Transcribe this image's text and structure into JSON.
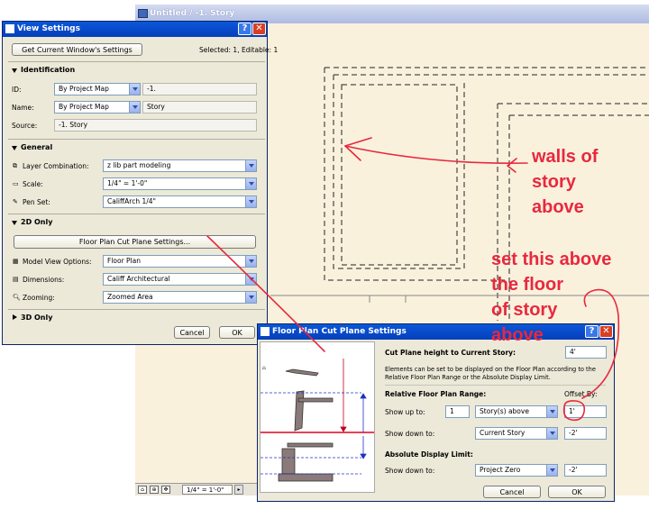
{
  "drawing_window": {
    "title": "Untitled / -1. Story",
    "scale": "1/4\"   =   1'-0\""
  },
  "view_settings": {
    "title": "View Settings",
    "get_settings_button": "Get Current Window's Settings",
    "selected_info": "Selected: 1, Editable: 1",
    "identification": {
      "header": "Identification",
      "id_label": "ID:",
      "id_select": "By Project Map",
      "id_value": "-1.",
      "name_label": "Name:",
      "name_select": "By Project Map",
      "name_value": "Story",
      "source_label": "Source:",
      "source_value": "-1. Story"
    },
    "general": {
      "header": "General",
      "layer_label": "Layer Combination:",
      "layer_value": "z lib part modeling",
      "scale_label": "Scale:",
      "scale_value": "1/4\"    =    1'-0\"",
      "penset_label": "Pen Set:",
      "penset_value": "CaliffArch 1/4\""
    },
    "two_d": {
      "header": "2D Only",
      "cutplane_button": "Floor Plan Cut Plane Settings...",
      "mvo_label": "Model View Options:",
      "mvo_value": "Floor Plan",
      "dim_label": "Dimensions:",
      "dim_value": "Califf Architectural",
      "zoom_label": "Zooming:",
      "zoom_value": "Zoomed Area"
    },
    "three_d": {
      "header": "3D Only"
    },
    "cancel": "Cancel",
    "ok": "OK"
  },
  "cut_plane": {
    "title": "Floor Plan Cut Plane Settings",
    "height_label": "Cut Plane height to Current Story:",
    "height_value": "4'",
    "description": "Elements can be set to be displayed on the Floor Plan according to the Relative Floor Plan Range or the Absolute Display Limit.",
    "relative_header": "Relative Floor Plan Range:",
    "offset_header": "Offset By:",
    "show_up_label": "Show up to:",
    "show_up_count": "1",
    "show_up_select": "Story(s) above",
    "show_up_offset": "1'",
    "show_down_label": "Show down to:",
    "show_down_select": "Current Story",
    "show_down_offset": "-2'",
    "absolute_header": "Absolute Display Limit:",
    "abs_down_label": "Show down to:",
    "abs_down_select": "Project Zero",
    "abs_down_offset": "-2'",
    "cancel": "Cancel",
    "ok": "OK"
  },
  "annotations": {
    "walls": [
      "walls of",
      "story",
      "above"
    ],
    "set": [
      "set this above",
      "the floor",
      "of story",
      "above"
    ]
  },
  "colors": {
    "annotation": "#e8283e",
    "titlebar": "#0848c8",
    "paper": "#faf1dd"
  }
}
